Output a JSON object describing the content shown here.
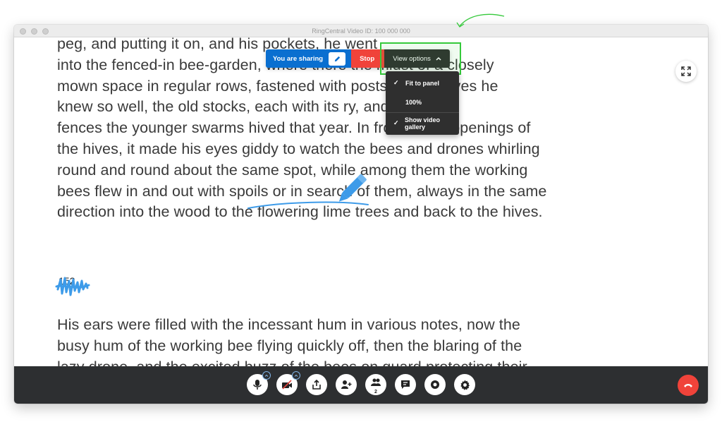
{
  "window": {
    "title": "RingCentral Video ID: 100 000 000"
  },
  "document": {
    "paragraphs": [
      [
        "peg, and putting it on, and                      his pockets, he went",
        "into the fenced-in bee-garden, where there                the midst of a closely",
        "mown space in regular rows, fastened with              posts, all the hives he",
        "knew so well, the old stocks, each with its                 ry, and along the",
        "fences the younger swarms hived that year. In front of the openings of",
        "the hives, it made his eyes giddy to watch the bees and drones whirling",
        "round and round about the same spot, while among them the working",
        "bees flew in and out with spoils or in search of them, always in the same",
        "direction into the wood to the flowering lime trees and back to the hives."
      ],
      [
        "His ears were filled with the incessant hum in various notes, now the",
        "busy hum of the working bee flying quickly off, then the blaring of the",
        "lazy drone, and the excited buzz of the bees on guard protecting their"
      ]
    ],
    "page_number": "152"
  },
  "sharing_bar": {
    "sharing_label": "You are sharing",
    "stop_label": "Stop",
    "view_options_label": "View options"
  },
  "view_menu": {
    "items": [
      {
        "label": "Fit to panel",
        "checked": "✓"
      },
      {
        "label": "100%",
        "checked": ""
      },
      {
        "label": "Show video gallery",
        "checked": "✓"
      }
    ]
  },
  "toolbar": {
    "participants_count": "2",
    "buttons": [
      "mute-audio",
      "stop-video",
      "share-screen",
      "invite",
      "participants",
      "chat",
      "record",
      "settings"
    ],
    "end_call": "end-call"
  },
  "colors": {
    "sharing_blue": "#0a6fd0",
    "stop_red": "#f0433a",
    "highlight_green": "#35c93b",
    "annotation_blue": "#3d9be9",
    "toolbar_dark": "#2d2f31"
  }
}
